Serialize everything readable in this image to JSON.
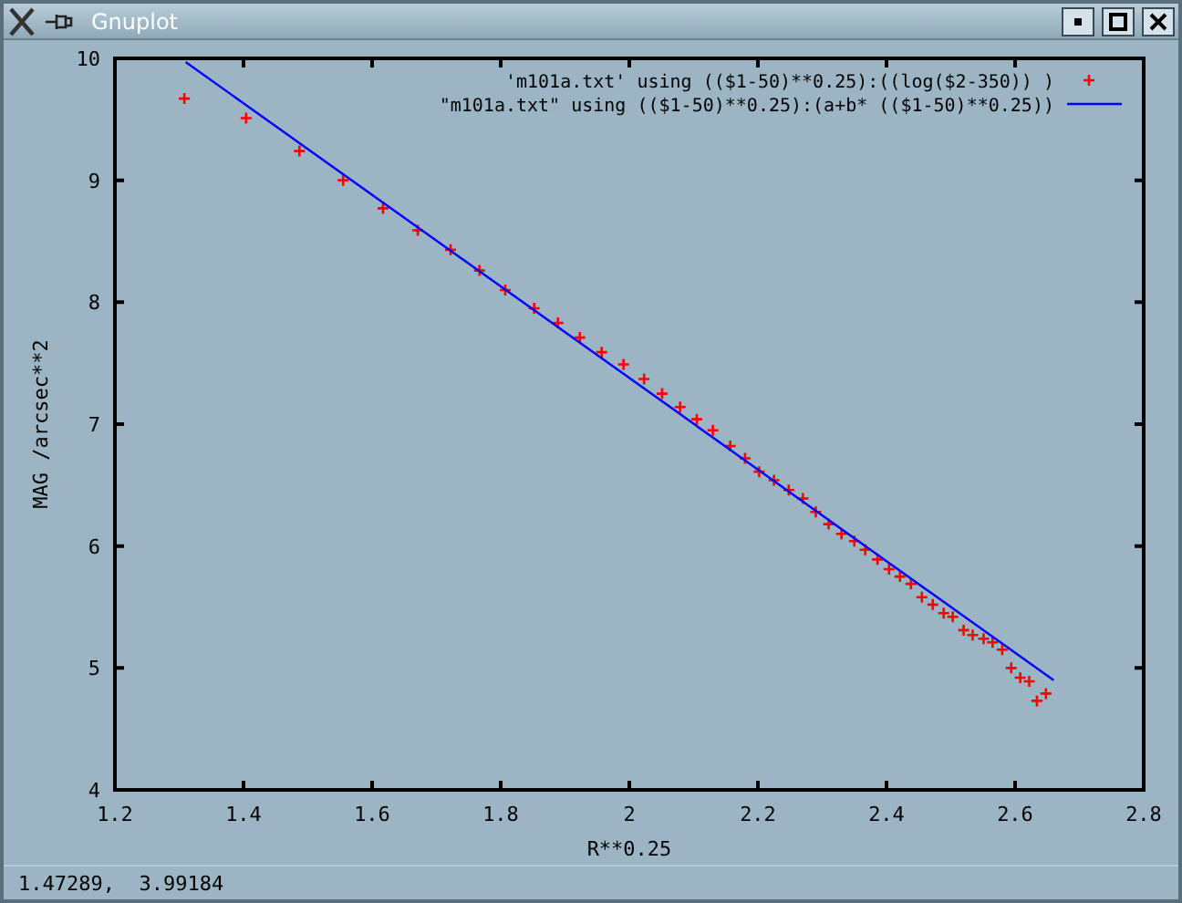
{
  "window": {
    "title": "Gnuplot"
  },
  "chart_data": {
    "type": "scatter",
    "xlabel": "R**0.25",
    "ylabel": "MAG /arcsec**2",
    "xlim": [
      1.2,
      2.8
    ],
    "ylim": [
      4,
      10
    ],
    "xticks": [
      1.2,
      1.4,
      1.6,
      1.8,
      2,
      2.2,
      2.4,
      2.6,
      2.8
    ],
    "yticks": [
      4,
      5,
      6,
      7,
      8,
      9,
      10
    ],
    "legend": "top right",
    "series": [
      {
        "name": "'m101a.txt' using (($1-50)**0.25):((log($2-350)) )",
        "color": "#ff0000",
        "type": "scatter",
        "x": [
          1.308,
          1.404,
          1.487,
          1.555,
          1.617,
          1.671,
          1.722,
          1.767,
          1.807,
          1.852,
          1.889,
          1.923,
          1.957,
          1.991,
          2.023,
          2.051,
          2.079,
          2.105,
          2.13,
          2.157,
          2.18,
          2.202,
          2.225,
          2.248,
          2.27,
          2.29,
          2.31,
          2.33,
          2.35,
          2.367,
          2.386,
          2.404,
          2.421,
          2.438,
          2.455,
          2.472,
          2.489,
          2.503,
          2.52,
          2.534,
          2.551,
          2.565,
          2.58,
          2.594,
          2.608,
          2.622,
          2.634,
          2.648
        ],
        "values": [
          9.67,
          9.51,
          9.24,
          9.0,
          8.77,
          8.59,
          8.43,
          8.26,
          8.1,
          7.95,
          7.83,
          7.71,
          7.59,
          7.49,
          7.37,
          7.25,
          7.14,
          7.04,
          6.95,
          6.82,
          6.72,
          6.61,
          6.54,
          6.46,
          6.39,
          6.28,
          6.18,
          6.1,
          6.04,
          5.97,
          5.89,
          5.81,
          5.75,
          5.69,
          5.58,
          5.52,
          5.45,
          5.42,
          5.31,
          5.27,
          5.24,
          5.21,
          5.15,
          5.0,
          4.92,
          4.89,
          4.73,
          4.79
        ]
      },
      {
        "name": "\"m101a.txt\" using (($1-50)**0.25):(a+b* (($1-50)**0.25))",
        "color": "#0000ff",
        "type": "line",
        "x": [
          1.31,
          2.66
        ],
        "values": [
          9.97,
          4.9
        ]
      }
    ]
  },
  "status_bar": {
    "text": "1.47289,  3.99184"
  }
}
